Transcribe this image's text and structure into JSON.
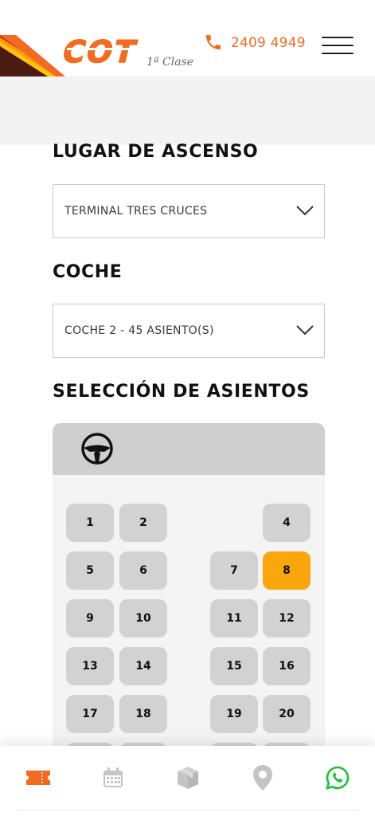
{
  "header": {
    "logo_text": "COT",
    "logo_subtext": "1ª Clase",
    "phone": "2409 4949",
    "icons": {
      "phone": "phone-icon",
      "menu": "hamburger-menu-icon"
    },
    "colors": {
      "brand_orange": "#f26b21",
      "stripe_red": "#e1251b",
      "stripe_yellow": "#ffc20e",
      "stripe_dark": "#4a1b0e"
    }
  },
  "boarding": {
    "title": "LUGAR DE ASCENSO",
    "selected": "TERMINAL TRES CRUCES"
  },
  "coach": {
    "title": "COCHE",
    "selected": "COCHE 2 - 45 ASIENTO(S)"
  },
  "seats": {
    "title": "SELECCIÓN DE ASIENTOS",
    "driver_icon": "steering-wheel-icon",
    "rows": [
      [
        "1",
        "2",
        "",
        "4"
      ],
      [
        "5",
        "6",
        "7",
        "8"
      ],
      [
        "9",
        "10",
        "11",
        "12"
      ],
      [
        "13",
        "14",
        "15",
        "16"
      ],
      [
        "17",
        "18",
        "19",
        "20"
      ],
      [
        "",
        "",
        "",
        ""
      ]
    ],
    "selected_seat": "8",
    "colors": {
      "available": "#d2d2d2",
      "selected": "#fba60c"
    }
  },
  "bottom_nav": {
    "items": [
      {
        "icon": "ticket-icon",
        "active": true
      },
      {
        "icon": "calendar-icon",
        "active": false
      },
      {
        "icon": "package-icon",
        "active": false
      },
      {
        "icon": "location-pin-icon",
        "active": false
      },
      {
        "icon": "whatsapp-icon",
        "active": false
      }
    ],
    "colors": {
      "active": "#f26b21",
      "inactive": "#c4c4c4",
      "whatsapp": "#1fbf3c"
    }
  }
}
